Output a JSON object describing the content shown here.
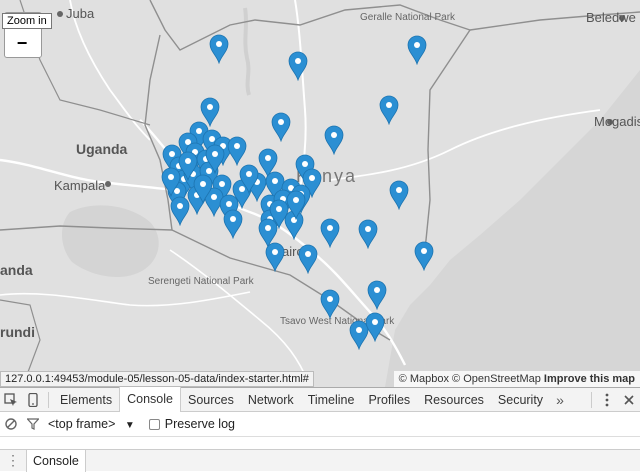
{
  "map": {
    "labels": {
      "juba": "Juba",
      "geralle": "Geralle National Park",
      "beledweyne": "Beledwe",
      "uganda": "Uganda",
      "kampala": "Kampala",
      "kenya": "Kenya",
      "mogadishu": "Mogadis",
      "rwanda": "anda",
      "burundi": "rundi",
      "serengeti": "Serengeti National Park",
      "tsavo": "Tsavo West National Park",
      "nairobi": "airob"
    },
    "zoom": {
      "tooltip": "Zoom in",
      "minus": "−"
    },
    "attribution": {
      "mapbox": "© Mapbox",
      "osm": "© OpenStreetMap",
      "improve": "Improve this map"
    },
    "status_url": "127.0.0.1:49453/module-05/lesson-05-data/index-starter.html#",
    "marker_color": "#2b8fd3",
    "marker_count": 56
  },
  "devtools": {
    "tabs": [
      "Elements",
      "Console",
      "Sources",
      "Network",
      "Timeline",
      "Profiles",
      "Resources",
      "Security"
    ],
    "active_tab": "Console",
    "more": "»",
    "frame_select": "<top frame>",
    "preserve_log": "Preserve log",
    "drawer_tab": "Console",
    "icons": {
      "inspect": "inspect-element-icon",
      "device": "device-mode-icon",
      "more_menu": "vertical-dots-icon",
      "close": "close-icon",
      "clear": "clear-console-icon",
      "filter": "filter-icon",
      "drawer": "drawer-handle-icon"
    }
  }
}
